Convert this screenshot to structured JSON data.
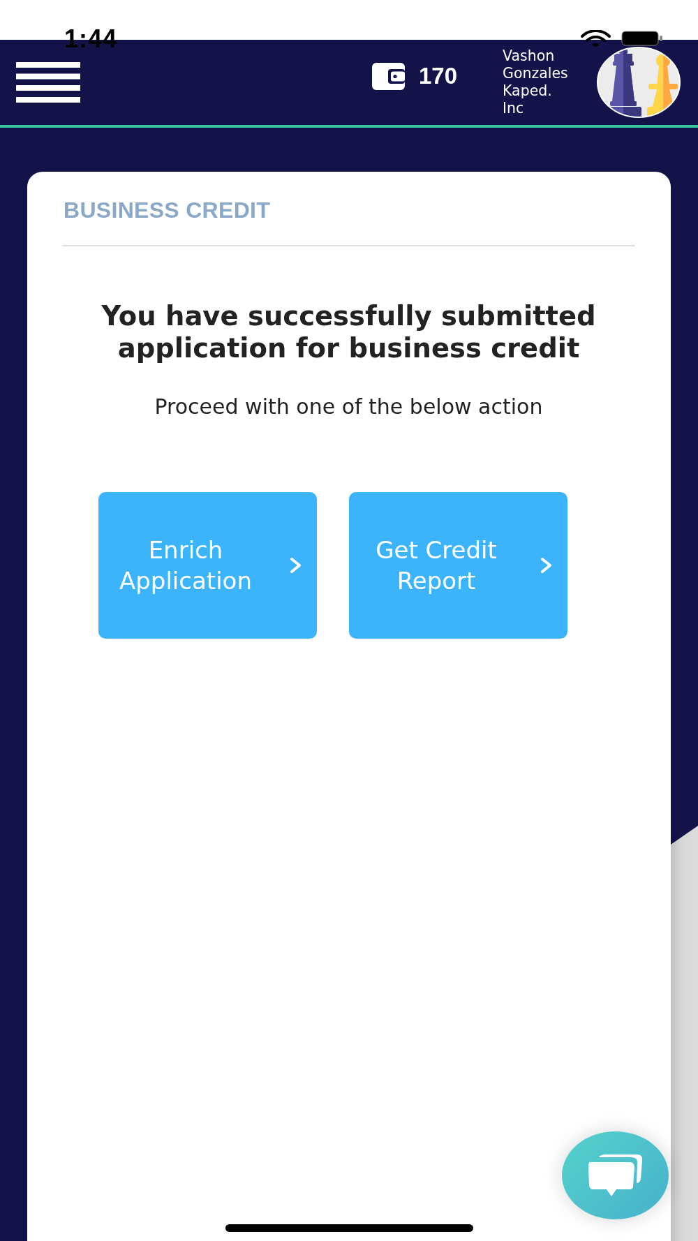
{
  "status_bar": {
    "time": "1:44"
  },
  "header": {
    "wallet_balance": "170",
    "account_name": "Vashon Gonzales Kaped. Inc"
  },
  "card": {
    "title": "BUSINESS CREDIT",
    "message": "You have successfully submitted application for business credit",
    "instruction": "Proceed with one of the below action",
    "actions": [
      {
        "label": "Enrich Application"
      },
      {
        "label": "Get Credit Report"
      }
    ]
  }
}
